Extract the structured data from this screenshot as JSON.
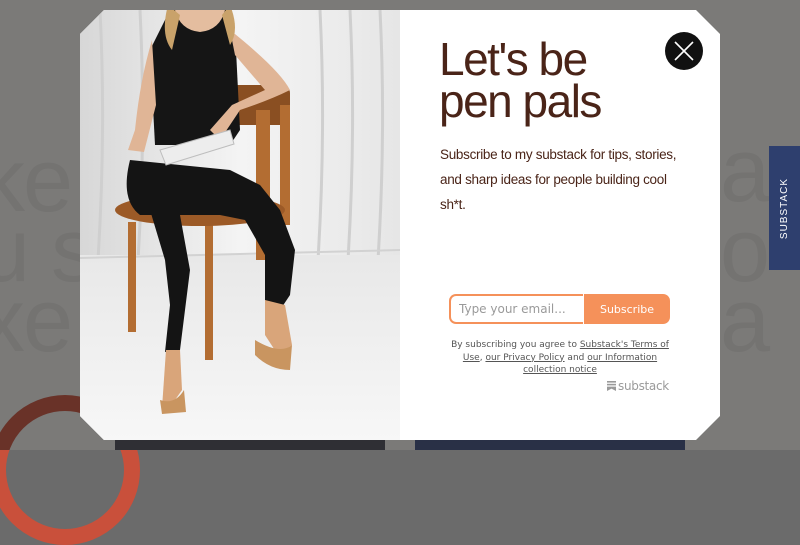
{
  "background": {
    "side_tab_label": "SUBSTACK",
    "accent_orange": "#c9503b",
    "accent_navy": "#2e3f6e"
  },
  "modal": {
    "close_icon": "close-icon",
    "headline_lines": [
      "Let's be",
      "pen pals"
    ],
    "subtitle_lines": [
      "Subscribe to my substack for tips, stories,",
      "and sharp ideas for people building cool",
      "sh*t."
    ],
    "email_placeholder": "Type your email...",
    "subscribe_label": "Subscribe",
    "legal": {
      "prefix": "By subscribing you agree to ",
      "terms_link": "Substack's Terms of Use",
      "separator": ", ",
      "privacy_link": "our Privacy Policy",
      "and": " and ",
      "info_link": "our Information collection notice"
    },
    "brand_label": "substack",
    "headline_color": "#4a2418",
    "button_color": "#f5915a"
  }
}
